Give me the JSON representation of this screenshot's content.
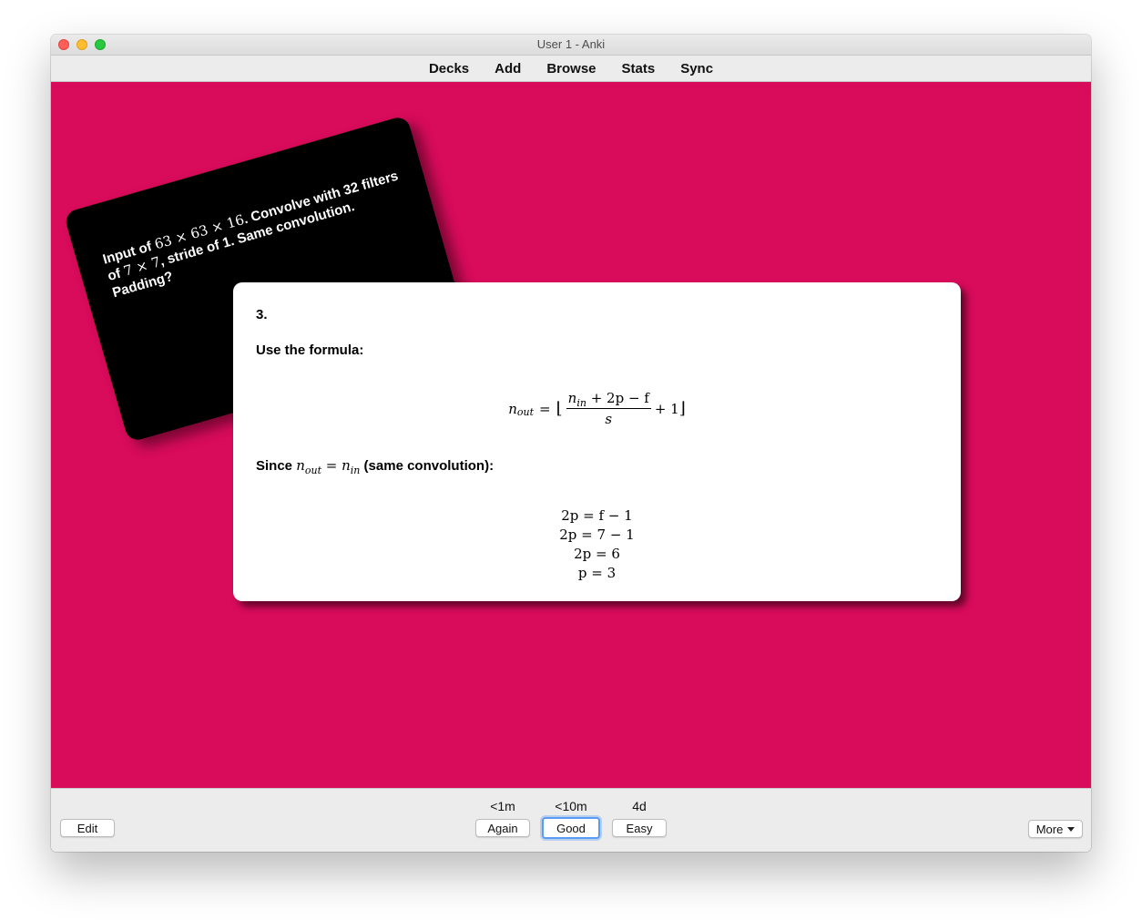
{
  "window": {
    "title": "User 1 - Anki"
  },
  "toolbar": {
    "links": [
      "Decks",
      "Add",
      "Browse",
      "Stats",
      "Sync"
    ]
  },
  "colors": {
    "background": "#d90b5b",
    "good_focus": "#5a9cf4"
  },
  "card": {
    "front": {
      "t1": "Input of ",
      "m1": "63 × 63 × 16",
      "t2": ". Convolve with 32 filters of ",
      "m2": "7 × 7",
      "t3": ", stride of 1. Same convolution. Padding?"
    },
    "back": {
      "step_number": "3.",
      "formula_label": "Use the formula:",
      "formula": {
        "lhs": "n",
        "lhs_sub": "out",
        "equals": "=",
        "floor_open": "⌊",
        "num_n": "n",
        "num_sub": "in",
        "num_rest": " + 2p − f",
        "den": "s",
        "plus_one": "+ 1",
        "floor_close": "⌋"
      },
      "since": {
        "prefix": "Since ",
        "n1": "n",
        "n1_sub": "out",
        "eq": " = ",
        "n2": "n",
        "n2_sub": "in",
        "suffix": " (same convolution):"
      },
      "equations": [
        "2p = f − 1",
        "2p = 7 − 1",
        "2p = 6",
        "p = 3"
      ]
    }
  },
  "answer_buttons": [
    {
      "interval": "<1m",
      "label": "Again"
    },
    {
      "interval": "<10m",
      "label": "Good"
    },
    {
      "interval": "4d",
      "label": "Easy"
    }
  ],
  "bottom": {
    "edit_label": "Edit",
    "more_label": "More"
  }
}
